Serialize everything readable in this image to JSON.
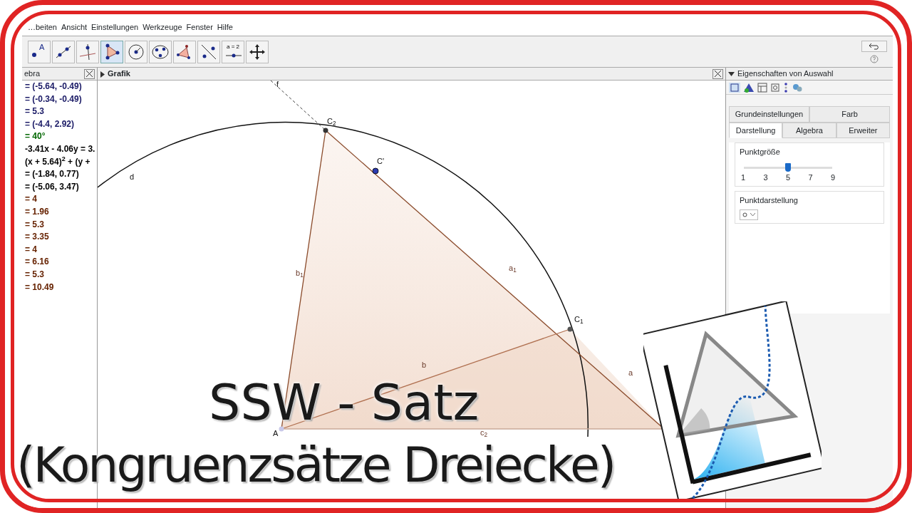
{
  "menu": [
    "…beiten",
    "Ansicht",
    "Einstellungen",
    "Werkzeuge",
    "Fenster",
    "Hilfe"
  ],
  "toolbar": [
    {
      "kind": "point",
      "label": "A",
      "selected": false
    },
    {
      "kind": "line",
      "selected": false
    },
    {
      "kind": "perpendicular",
      "selected": false
    },
    {
      "kind": "polygon",
      "selected": true
    },
    {
      "kind": "circle",
      "selected": false
    },
    {
      "kind": "conic",
      "selected": false
    },
    {
      "kind": "angle",
      "selected": false
    },
    {
      "kind": "reflect",
      "selected": false
    },
    {
      "kind": "slider",
      "label": "a = 2",
      "selected": false
    },
    {
      "kind": "move",
      "selected": false
    }
  ],
  "algebra": {
    "title": "ebra",
    "items": [
      {
        "text": "= (-5.64, -0.49)",
        "color": "#1a1a66"
      },
      {
        "text": "= (-0.34, -0.49)",
        "color": "#1a1a66"
      },
      {
        "text": "= 5.3",
        "color": "#1a1a66"
      },
      {
        "text": "= (-4.4, 2.92)",
        "color": "#1a1a66"
      },
      {
        "text": "= 40°",
        "color": "#006600"
      },
      {
        "text": "-3.41x - 4.06y = 3.",
        "color": "#000000"
      },
      {
        "text": "(x + 5.64)$^{2}$ + (y +",
        "color": "#000000"
      },
      {
        "text": "= (-1.84, 0.77)",
        "color": "#000000"
      },
      {
        "text": "= (-5.06, 3.47)",
        "color": "#000000"
      },
      {
        "text": "= 4",
        "color": "#662200"
      },
      {
        "text": "= 1.96",
        "color": "#662200"
      },
      {
        "text": "= 5.3",
        "color": "#662200"
      },
      {
        "text": "= 3.35",
        "color": "#662200"
      },
      {
        "text": "= 4",
        "color": "#662200"
      },
      {
        "text": "= 6.16",
        "color": "#662200"
      },
      {
        "text": "= 5.3",
        "color": "#662200"
      },
      {
        "text": "= 10.49",
        "color": "#662200"
      }
    ]
  },
  "graphics": {
    "title": "Grafik",
    "labels": [
      {
        "text": "f",
        "kind": "line"
      },
      {
        "text": "d",
        "kind": "circle"
      },
      {
        "text": "C$_{2}$",
        "kind": "point"
      },
      {
        "text": "C'",
        "kind": "point"
      },
      {
        "text": "b$_{1}$",
        "kind": "segment"
      },
      {
        "text": "a$_{1}$",
        "kind": "segment"
      },
      {
        "text": "C$_{1}$",
        "kind": "point"
      },
      {
        "text": "b",
        "kind": "segment"
      },
      {
        "text": "a",
        "kind": "segment"
      },
      {
        "text": "c$_{2}$",
        "kind": "segment"
      },
      {
        "text": "A",
        "kind": "point"
      }
    ]
  },
  "properties": {
    "title": "Eigenschaften von Auswahl",
    "tabs_top": [
      {
        "label": "Grundeinstellungen",
        "selected": false
      },
      {
        "label": "Farb",
        "selected": false
      }
    ],
    "tabs": [
      {
        "label": "Darstellung",
        "selected": true
      },
      {
        "label": "Algebra",
        "selected": false
      },
      {
        "label": "Erweiter",
        "selected": false
      }
    ],
    "point_size": {
      "label": "Punktgröße",
      "level": 0.5,
      "ticks": [
        "1",
        "3",
        "5",
        "7",
        "9"
      ]
    },
    "point_style": {
      "label": "Punktdarstellung"
    }
  },
  "overlay": {
    "title": "SSW - Satz",
    "subtitle": "(Kongruenzsätze Dreiecke)"
  }
}
